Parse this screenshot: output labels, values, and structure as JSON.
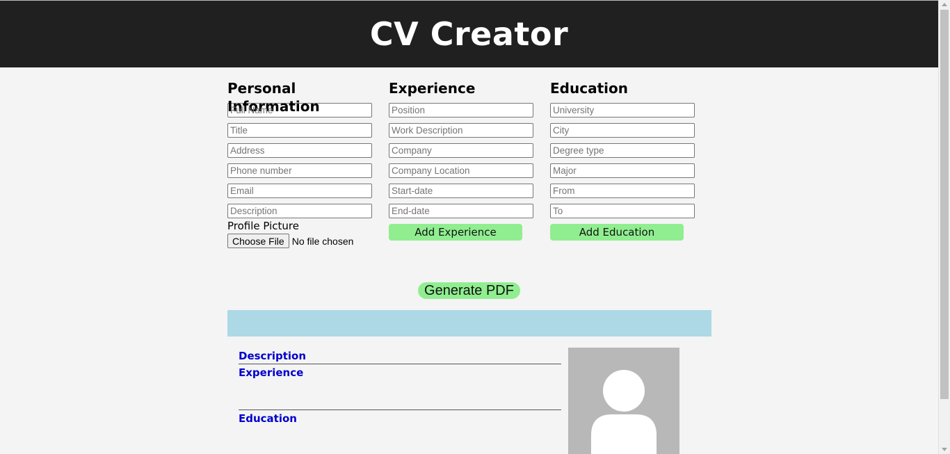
{
  "app": {
    "title": "CV Creator"
  },
  "personal": {
    "heading": "Personal Information",
    "fields": [
      "Full Name",
      "Title",
      "Address",
      "Phone number",
      "Email",
      "Description"
    ],
    "picture_label": "Profile Picture",
    "file_button": "Choose File",
    "file_status": "No file chosen"
  },
  "experience": {
    "heading": "Experience",
    "fields": [
      "Position",
      "Work Description",
      "Company",
      "Company Location",
      "Start-date",
      "End-date"
    ],
    "add_button": "Add Experience"
  },
  "education": {
    "heading": "Education",
    "fields": [
      "University",
      "City",
      "Degree type",
      "Major",
      "From",
      "To"
    ],
    "add_button": "Add Education"
  },
  "generate_button": "Generate PDF",
  "preview": {
    "sections": [
      "Description",
      "Experience",
      "Education"
    ]
  },
  "colors": {
    "header_bg": "#212020",
    "page_bg": "#f4f4f4",
    "button_green": "#90ee90",
    "preview_header": "#add8e6",
    "section_title": "#0000cd",
    "avatar_bg": "#b8b8b8"
  },
  "icons": [
    "default-avatar-icon"
  ]
}
